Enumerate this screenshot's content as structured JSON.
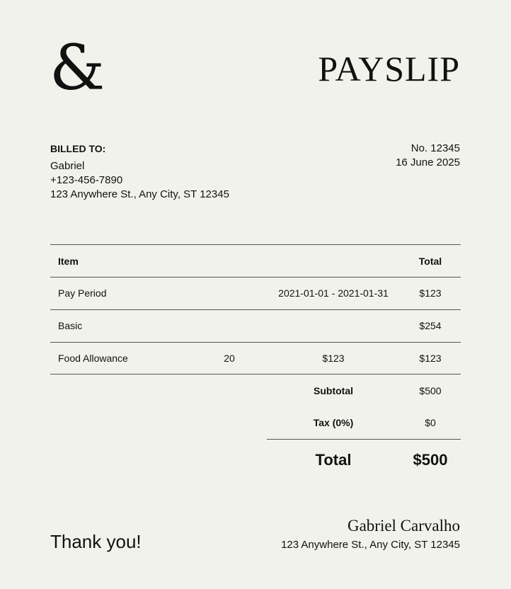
{
  "logo": "&",
  "title": "PAYSLIP",
  "billed_to": {
    "label": "BILLED TO:",
    "name": "Gabriel",
    "phone": "+123-456-7890",
    "address": "123 Anywhere St., Any City, ST 12345"
  },
  "invoice": {
    "number": "No. 12345",
    "date": "16 June 2025"
  },
  "table": {
    "headers": {
      "item": "Item",
      "total": "Total"
    },
    "rows": [
      {
        "item": "Pay Period",
        "qty": "",
        "price": "2021-01-01 - 2021-01-31",
        "total": "$123"
      },
      {
        "item": "Basic",
        "qty": "",
        "price": "",
        "total": "$254"
      },
      {
        "item": "Food Allowance",
        "qty": "20",
        "price": "$123",
        "total": "$123"
      }
    ]
  },
  "summary": {
    "subtotal_label": "Subtotal",
    "subtotal_value": "$500",
    "tax_label": "Tax (0%)",
    "tax_value": "$0",
    "total_label": "Total",
    "total_value": "$500"
  },
  "footer": {
    "thanks": "Thank you!",
    "signature_name": "Gabriel Carvalho",
    "signature_address": "123 Anywhere St., Any City, ST 12345"
  }
}
